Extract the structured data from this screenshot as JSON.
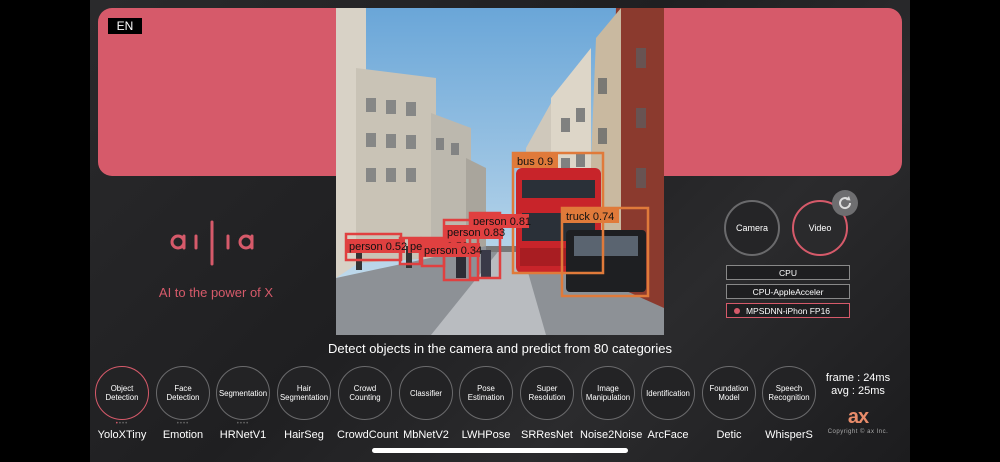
{
  "language_badge": "EN",
  "brand": {
    "logo_text": "ailia",
    "tagline": "AI to the power of X",
    "logo_color": "#d65a6a"
  },
  "camera": {
    "caption": "Detect objects in the camera and predict from 80 categories",
    "detections": [
      {
        "label": "bus 0.9",
        "color": "#e07a3a"
      },
      {
        "label": "truck 0.74",
        "color": "#e07a3a"
      },
      {
        "label": "person 0.81",
        "color": "#e04040"
      },
      {
        "label": "person 0.83",
        "color": "#e04040"
      },
      {
        "label": "person 0.52",
        "color": "#e04040"
      },
      {
        "label": "person 0.52",
        "color": "#e04040"
      },
      {
        "label": "person 0.34",
        "color": "#e04040"
      }
    ]
  },
  "source_buttons": {
    "camera": "Camera",
    "video": "Video"
  },
  "backends": [
    {
      "label": "CPU",
      "selected": false
    },
    {
      "label": "CPU-AppleAcceler",
      "selected": false
    },
    {
      "label": "MPSDNN-iPhon FP16",
      "selected": true
    }
  ],
  "categories": [
    {
      "label": "Object Detection",
      "model": "YoloXTiny",
      "selected": true
    },
    {
      "label": "Face Detection",
      "model": "Emotion",
      "selected": false
    },
    {
      "label": "Segmentation",
      "model": "HRNetV1",
      "selected": false
    },
    {
      "label": "Hair Segmentation",
      "model": "HairSeg",
      "selected": false
    },
    {
      "label": "Crowd Counting",
      "model": "CrowdCount",
      "selected": false
    },
    {
      "label": "Classifier",
      "model": "MbNetV2",
      "selected": false
    },
    {
      "label": "Pose Estimation",
      "model": "LWHPose",
      "selected": false
    },
    {
      "label": "Super Resolution",
      "model": "SRResNet",
      "selected": false
    },
    {
      "label": "Image Manipulation",
      "model": "Noise2Noise",
      "selected": false
    },
    {
      "label": "Identification",
      "model": "ArcFace",
      "selected": false
    },
    {
      "label": "Foundation Model",
      "model": "Detic",
      "selected": false
    },
    {
      "label": "Speech Recognition",
      "model": "WhisperS",
      "selected": false
    }
  ],
  "stats": {
    "frame": "frame : 24ms",
    "avg": "avg : 25ms"
  },
  "footer": {
    "brand": "ax",
    "copyright": "Copyright © ax Inc."
  },
  "colors": {
    "accent": "#d65a6a",
    "background": "#252527"
  }
}
